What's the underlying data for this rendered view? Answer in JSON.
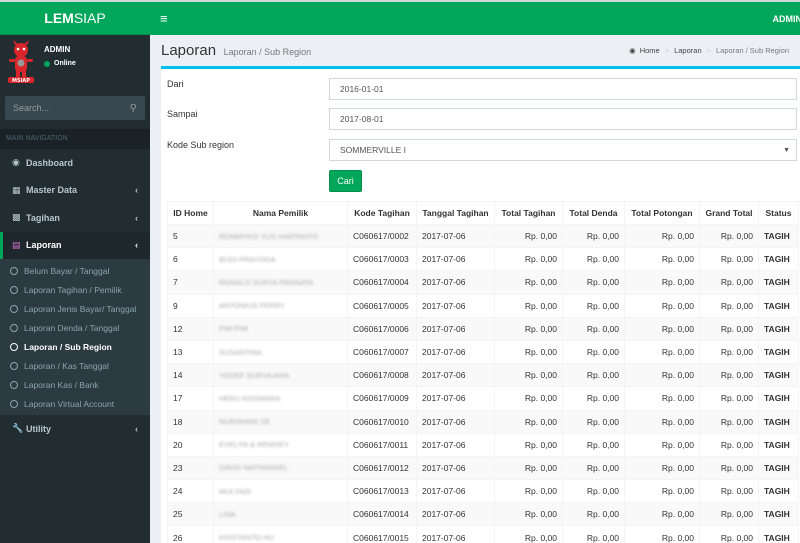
{
  "app": {
    "logo_bold": "LEM",
    "logo_rest": "SIAP",
    "nav_user": "ADMIN"
  },
  "sidebar": {
    "user": {
      "name": "ADMIN",
      "status": "Online"
    },
    "search_placeholder": "Search...",
    "header": "MAIN NAVIGATION",
    "items": [
      {
        "label": "Dashboard",
        "icon": "dashboard-icon"
      },
      {
        "label": "Master Data",
        "icon": "sitemap-icon"
      },
      {
        "label": "Tagihan",
        "icon": "money-icon"
      },
      {
        "label": "Laporan",
        "icon": "area-chart-icon"
      },
      {
        "label": "Utility",
        "icon": "wrench-icon"
      }
    ],
    "submenu": [
      "Belum Bayar / Tanggal",
      "Laporan Tagihan / Pemilik",
      "Laporan Jenis Bayar/ Tanggal",
      "Laporan Denda / Tanggal",
      "Laporan / Sub Region",
      "Laporan / Kas Tanggal",
      "Laporan Kas / Bank",
      "Laporan Virtual Account"
    ]
  },
  "header": {
    "title": "Laporan",
    "subtitle": "Laporan / Sub Region",
    "breadcrumb": [
      "Home",
      "Laporan",
      "Laporan / Sub Region"
    ]
  },
  "form": {
    "dari_label": "Dari",
    "dari_value": "2016-01-01",
    "sampai_label": "Sampai",
    "sampai_value": "2017-08-01",
    "subregion_label": "Kode Sub region",
    "subregion_value": "SOMMERVILLE I",
    "submit_label": "Cari"
  },
  "table": {
    "columns": [
      "ID Home",
      "Nama Pemilik",
      "Kode Tagihan",
      "Tanggal Tagihan",
      "Total Tagihan",
      "Total Denda",
      "Total Potongan",
      "Grand Total",
      "Status"
    ],
    "rows": [
      [
        "5",
        "ROMMYKO YUS HARTANTO",
        "C060617/0002",
        "2017-07-06",
        "Rp. 0,00",
        "Rp. 0,00",
        "Rp. 0,00",
        "Rp. 0,00",
        "TAGIH"
      ],
      [
        "6",
        "BUDI PRAYOGA",
        "C060617/0003",
        "2017-07-06",
        "Rp. 0,00",
        "Rp. 0,00",
        "Rp. 0,00",
        "Rp. 0,00",
        "TAGIH"
      ],
      [
        "7",
        "RONALD SURYA PRANATA",
        "C060617/0004",
        "2017-07-06",
        "Rp. 0,00",
        "Rp. 0,00",
        "Rp. 0,00",
        "Rp. 0,00",
        "TAGIH"
      ],
      [
        "9",
        "ANTONIUS FERRY",
        "C060617/0005",
        "2017-07-06",
        "Rp. 0,00",
        "Rp. 0,00",
        "Rp. 0,00",
        "Rp. 0,00",
        "TAGIH"
      ],
      [
        "12",
        "PIM PIM",
        "C060617/0006",
        "2017-07-06",
        "Rp. 0,00",
        "Rp. 0,00",
        "Rp. 0,00",
        "Rp. 0,00",
        "TAGIH"
      ],
      [
        "13",
        "SUSANTINA",
        "C060617/0007",
        "2017-07-06",
        "Rp. 0,00",
        "Rp. 0,00",
        "Rp. 0,00",
        "Rp. 0,00",
        "TAGIH"
      ],
      [
        "14",
        "YOSEF SURYAJAYA",
        "C060617/0008",
        "2017-07-06",
        "Rp. 0,00",
        "Rp. 0,00",
        "Rp. 0,00",
        "Rp. 0,00",
        "TAGIH"
      ],
      [
        "17",
        "HERU KOSWARA",
        "C060617/0009",
        "2017-07-06",
        "Rp. 0,00",
        "Rp. 0,00",
        "Rp. 0,00",
        "Rp. 0,00",
        "TAGIH"
      ],
      [
        "18",
        "NURSHANI SE",
        "C060617/0010",
        "2017-07-06",
        "Rp. 0,00",
        "Rp. 0,00",
        "Rp. 0,00",
        "Rp. 0,00",
        "TAGIH"
      ],
      [
        "20",
        "EVELYN & REMSEY",
        "C060617/0011",
        "2017-07-06",
        "Rp. 0,00",
        "Rp. 0,00",
        "Rp. 0,00",
        "Rp. 0,00",
        "TAGIH"
      ],
      [
        "23",
        "DAVID NATHANAEL",
        "C060617/0012",
        "2017-07-06",
        "Rp. 0,00",
        "Rp. 0,00",
        "Rp. 0,00",
        "Rp. 0,00",
        "TAGIH"
      ],
      [
        "24",
        "MULYADI",
        "C060617/0013",
        "2017-07-06",
        "Rp. 0,00",
        "Rp. 0,00",
        "Rp. 0,00",
        "Rp. 0,00",
        "TAGIH"
      ],
      [
        "25",
        "LINA",
        "C060617/0014",
        "2017-07-06",
        "Rp. 0,00",
        "Rp. 0,00",
        "Rp. 0,00",
        "Rp. 0,00",
        "TAGIH"
      ],
      [
        "26",
        "KRISTANTO HU",
        "C060617/0015",
        "2017-07-06",
        "Rp. 0,00",
        "Rp. 0,00",
        "Rp. 0,00",
        "Rp. 0,00",
        "TAGIH"
      ]
    ]
  },
  "colors": {
    "brand_green": "#00a65a",
    "sidebar_bg": "#222d32",
    "box_accent": "#00c0ef"
  }
}
